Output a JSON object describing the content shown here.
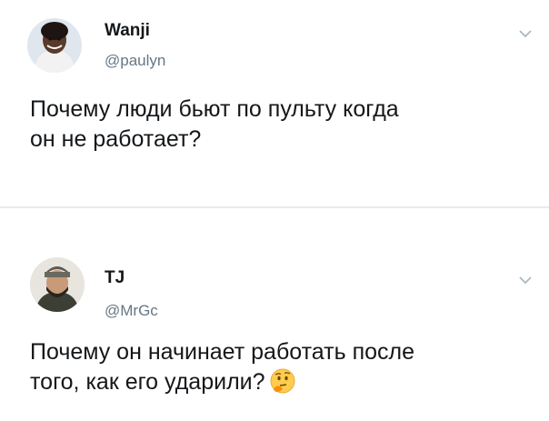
{
  "tweets": [
    {
      "display_name": "Wanji",
      "handle": "@paulyn",
      "text_line1": "Почему люди бьют по пульту когда",
      "text_line2": "он не работает?",
      "avatar_icon": "user-avatar-woman"
    },
    {
      "display_name": "TJ",
      "handle": "@MrGc",
      "text_line1": "Почему он начинает работать после",
      "text_line2": "того, как его ударили?",
      "avatar_icon": "user-avatar-man",
      "emoji": "thinking-face-emoji"
    }
  ],
  "colors": {
    "text": "#14171a",
    "secondary": "#657786",
    "divider": "#e6ecf0",
    "chevron": "#aab8c2"
  }
}
